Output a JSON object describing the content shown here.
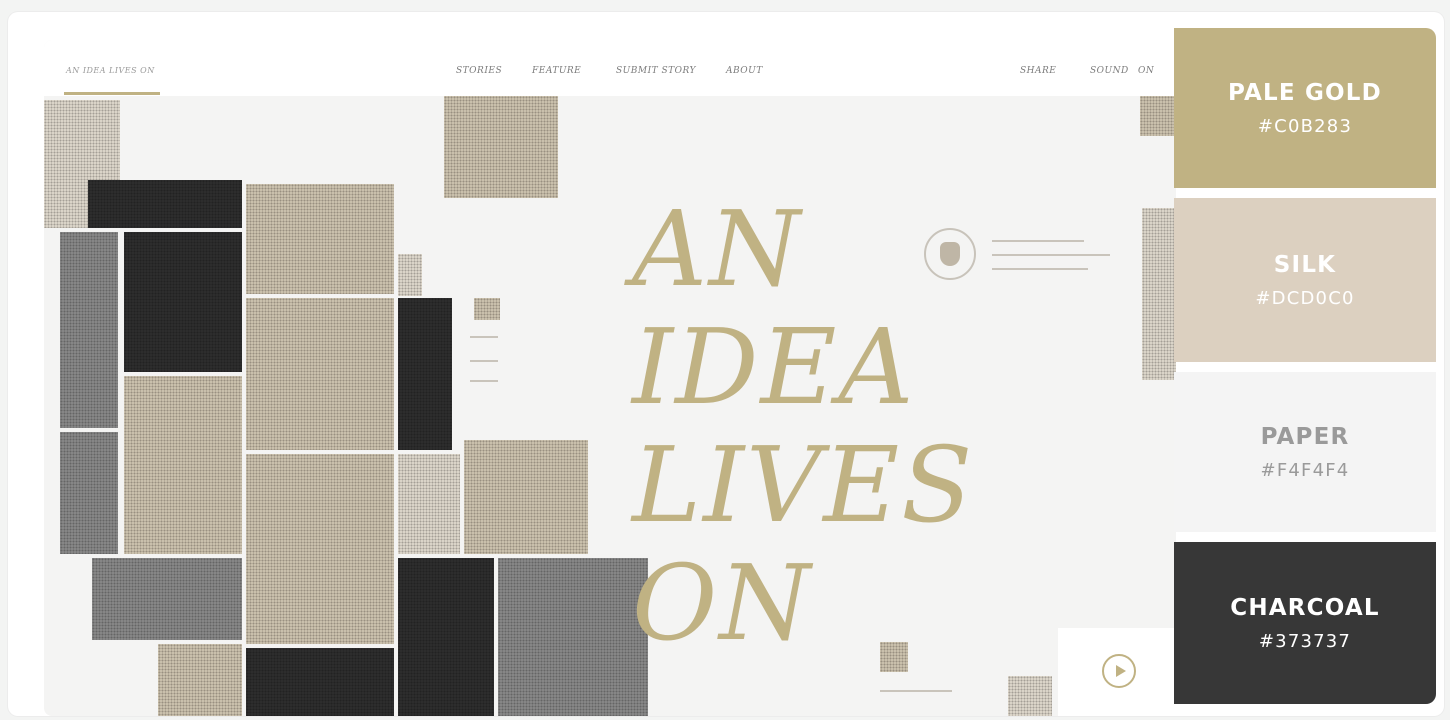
{
  "site": {
    "brand": "AN IDEA LIVES ON",
    "nav": [
      "STORIES",
      "FEATURE",
      "SUBMIT STORY",
      "ABOUT"
    ],
    "share_label": "SHARE",
    "sound_label": "SOUND",
    "sound_state": "ON",
    "headline": [
      "AN",
      "IDEA",
      "LIVES",
      "ON"
    ]
  },
  "palette": [
    {
      "name": "PALE GOLD",
      "hex": "#C0B283",
      "color": "#c0b283",
      "text_color": "#ffffff"
    },
    {
      "name": "SILK",
      "hex": "#DCD0C0",
      "color": "#dcd0c0",
      "text_color": "#ffffff"
    },
    {
      "name": "PAPER",
      "hex": "#F4F4F4",
      "color": "#f4f4f4",
      "text_color": "#9a9a9a"
    },
    {
      "name": "CHARCOAL",
      "hex": "#373737",
      "color": "#373737",
      "text_color": "#ffffff"
    }
  ],
  "colors": {
    "accent": "#c0b283",
    "background": "#f4f4f4"
  }
}
